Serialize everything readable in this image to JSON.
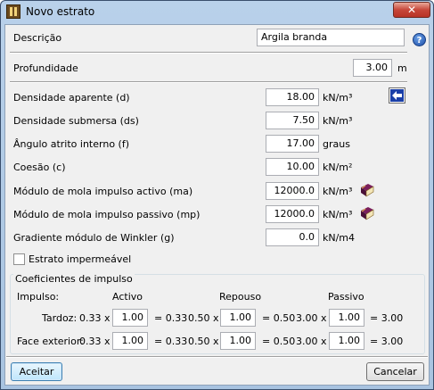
{
  "window": {
    "title": "Novo estrato",
    "close_glyph": "✕"
  },
  "descricao": {
    "label": "Descrição",
    "value": "Argila branda"
  },
  "help": {
    "glyph": "?"
  },
  "profundidade": {
    "label": "Profundidade",
    "value": "3.00",
    "unit": "m"
  },
  "properties": [
    {
      "label": "Densidade aparente (d)",
      "value": "18.00",
      "unit": "kN/m³"
    },
    {
      "label": "Densidade submersa (ds)",
      "value": "7.50",
      "unit": "kN/m³"
    },
    {
      "label": "Ângulo atrito interno (f)",
      "value": "17.00",
      "unit": "graus"
    },
    {
      "label": "Coesão (c)",
      "value": "10.00",
      "unit": "kN/m²"
    },
    {
      "label": "Módulo de mola impulso activo (ma)",
      "value": "12000.0",
      "unit": "kN/m³"
    },
    {
      "label": "Módulo de mola impulso passivo (mp)",
      "value": "12000.0",
      "unit": "kN/m³"
    },
    {
      "label": "Gradiente módulo de Winkler (g)",
      "value": "0.0",
      "unit": "kN/m4"
    }
  ],
  "impermeavel": {
    "label": "Estrato impermeável",
    "checked": false
  },
  "coeficientes": {
    "title": "Coeficientes de impulso",
    "impulso_label": "Impulso:",
    "headers": {
      "activo": "Activo",
      "repouso": "Repouso",
      "passivo": "Passivo"
    },
    "rows": [
      {
        "label": "Tardoz:",
        "activo_base": "0.33 x",
        "activo_value": "1.00",
        "activo_result": "= 0.33",
        "repouso_base": "0.50 x",
        "repouso_value": "1.00",
        "repouso_result": "= 0.50",
        "passivo_base": "3.00 x",
        "passivo_value": "1.00",
        "passivo_result": "= 3.00"
      },
      {
        "label": "Face exterior:",
        "activo_base": "0.33 x",
        "activo_value": "1.00",
        "activo_result": "= 0.33",
        "repouso_base": "0.50 x",
        "repouso_value": "1.00",
        "repouso_result": "= 0.50",
        "passivo_base": "3.00 x",
        "passivo_value": "1.00",
        "passivo_result": "= 3.00"
      }
    ]
  },
  "buttons": {
    "accept": "Aceitar",
    "cancel": "Cancelar"
  }
}
